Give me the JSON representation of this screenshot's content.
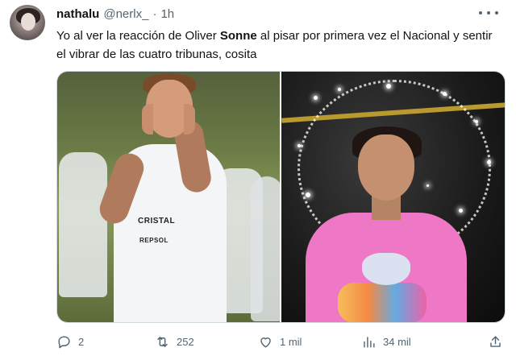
{
  "tweet": {
    "display_name": "nathalu",
    "handle": "@nerlx_",
    "separator": "·",
    "time": "1h",
    "text_before": "Yo al ver la reacción de Oliver ",
    "text_bold": "Sonne",
    "text_after": " al pisar por primera vez el Nacional y sentir el vibrar de las cuatro tribunas, cosita"
  },
  "media": {
    "left_shirt_line1": "CRISTAL",
    "left_shirt_line2": "REPSOL"
  },
  "actions": {
    "replies": "2",
    "retweets": "252",
    "likes": "1 mil",
    "views": "34 mil"
  },
  "icons": {
    "more": "more-horizontal-icon",
    "reply": "comment-icon",
    "retweet": "retweet-icon",
    "like": "heart-icon",
    "views": "bar-chart-icon",
    "share": "share-icon"
  },
  "colors": {
    "text_primary": "#0f1419",
    "text_secondary": "#536471",
    "border": "#cfd9de"
  }
}
